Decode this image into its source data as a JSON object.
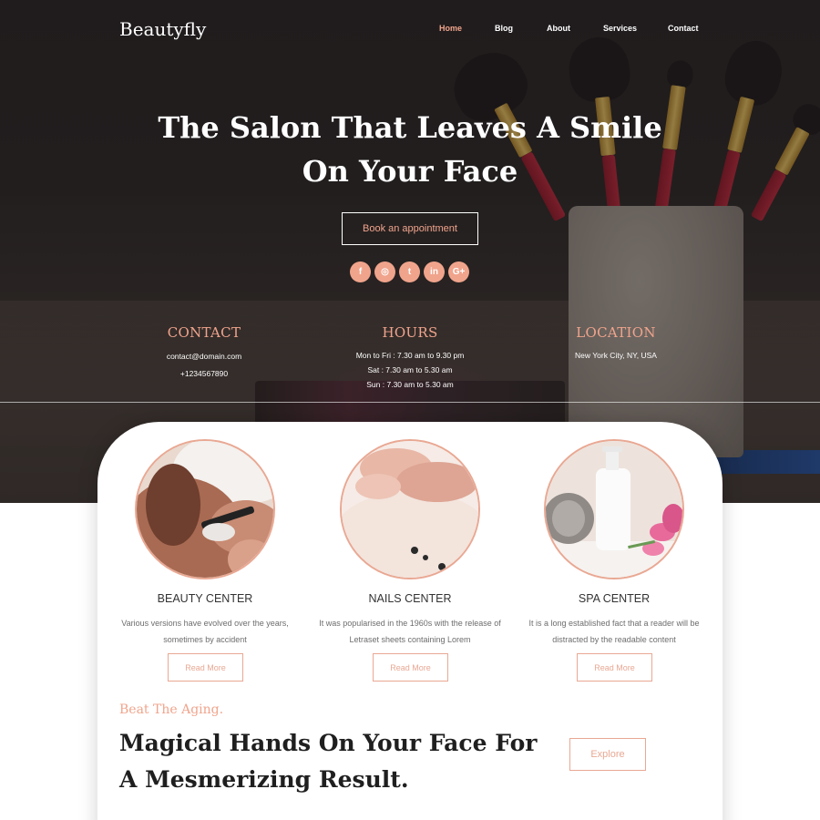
{
  "header": {
    "logo": "Beautyfly",
    "nav": [
      "Home",
      "Blog",
      "About",
      "Services",
      "Contact"
    ],
    "active_nav": "Home"
  },
  "hero": {
    "title": "The Salon That Leaves A Smile On Your Face",
    "cta_label": "Book an appointment",
    "social_icons": [
      "facebook-icon",
      "instagram-icon",
      "twitter-icon",
      "linkedin-icon",
      "google-plus-icon"
    ],
    "social_glyphs": [
      "f",
      "◎",
      "t",
      "in",
      "G+"
    ]
  },
  "info": {
    "contact": {
      "title": "CONTACT",
      "lines": [
        "contact@domain.com",
        "+1234567890"
      ]
    },
    "hours": {
      "title": "HOURS",
      "lines": [
        "Mon to Fri : 7.30 am to 9.30 pm",
        "Sat : 7.30 am to 5.30 am",
        "Sun : 7.30 am to 5.30 am"
      ]
    },
    "location": {
      "title": "LOCATION",
      "lines": [
        "New York City, NY, USA"
      ]
    }
  },
  "services": [
    {
      "title": "BEAUTY CENTER",
      "text": "Various versions have evolved over the years, sometimes by accident",
      "button": "Read More"
    },
    {
      "title": "NAILS CENTER",
      "text": "It was popularised in the 1960s with the release of Letraset sheets containing Lorem",
      "button": "Read More"
    },
    {
      "title": "SPA CENTER",
      "text": "It is a long established fact that a reader will be distracted by the readable content",
      "button": "Read More"
    }
  ],
  "promo": {
    "tagline": "Beat The Aging.",
    "headline": "Magical Hands On Your Face For A Mesmerizing Result.",
    "button": "Explore"
  },
  "colors": {
    "accent": "#f0a48c",
    "button_border": "#e9a893",
    "text_dark": "#1f1f1f"
  }
}
